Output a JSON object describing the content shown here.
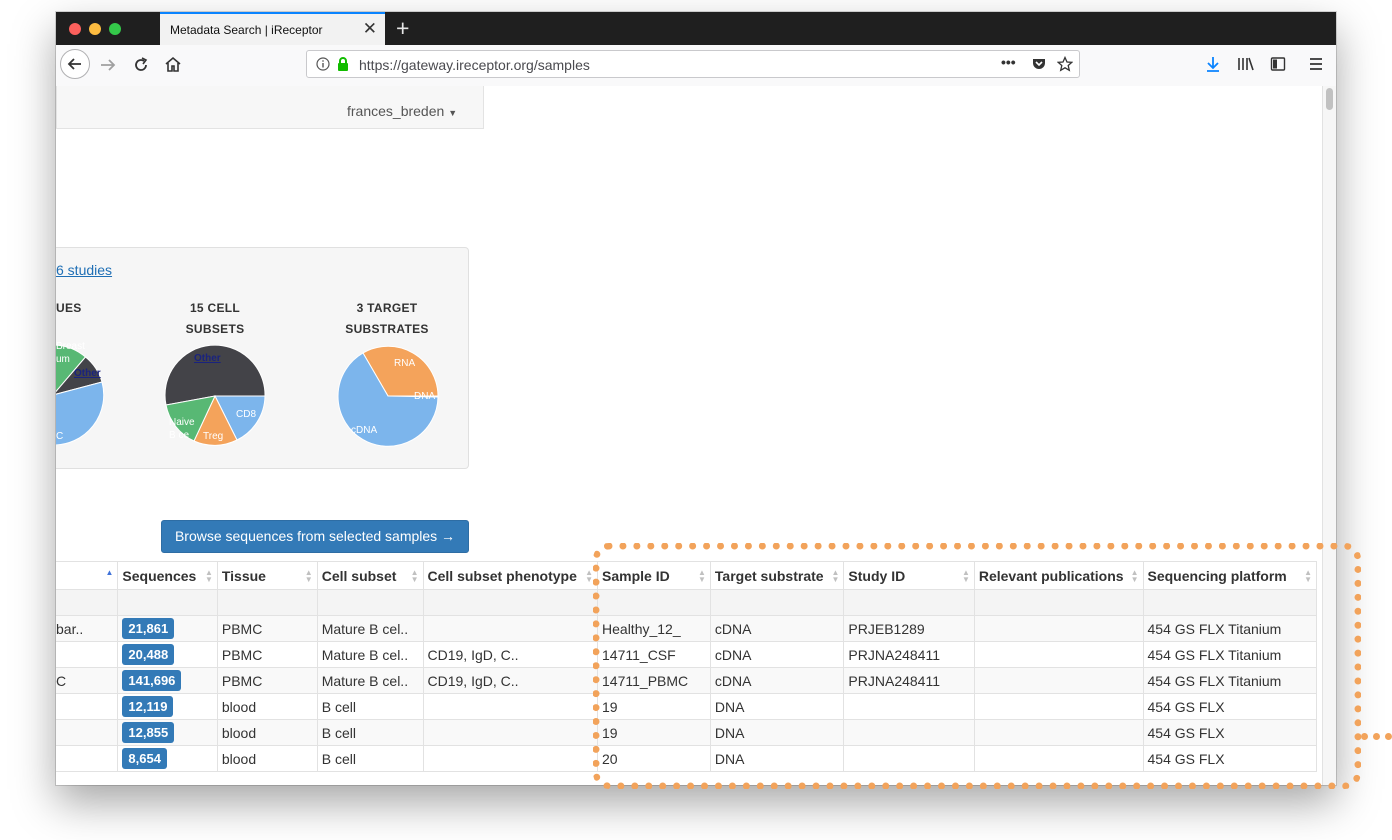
{
  "browser": {
    "tab_title": "Metadata Search | iReceptor",
    "url": "https://gateway.ireceptor.org/samples",
    "page_actions_icon": "•••",
    "new_tab_label": "+"
  },
  "header": {
    "username": "frances_breden"
  },
  "stats": {
    "studies_link": "6 studies",
    "tissues_heading": "UES",
    "cell_subsets_heading_line1": "15 CELL",
    "cell_subsets_heading_line2": "SUBSETS",
    "target_substrates_heading_line1": "3 TARGET",
    "target_substrates_heading_line2": "SUBSTRATES",
    "tissue_labels": [
      "Breast",
      "um",
      "Other",
      "C"
    ],
    "cell_subset_labels": [
      "Other",
      "CD8",
      "Naive",
      "B ce",
      "Treg"
    ],
    "substrate_labels": [
      "RNA",
      "DNA",
      "cDNA"
    ]
  },
  "colors": {
    "blue": "#7cb5ec",
    "dark": "#434348",
    "green": "#58b874",
    "orange": "#f4a35b",
    "badge": "#337ab7",
    "highlight": "#f2a35b"
  },
  "actions": {
    "browse_button": "Browse sequences from selected samples →"
  },
  "table": {
    "headers": [
      "Sequences",
      "Tissue",
      "Cell subset",
      "Cell subset phenotype",
      "Sample ID",
      "Target substrate",
      "Study ID",
      "Relevant publications",
      "Sequencing platform"
    ],
    "rows": [
      {
        "first": "bar..",
        "sequences": "21,861",
        "tissue": "PBMC",
        "cell_subset": "Mature B cel..",
        "phenotype": "",
        "sample_id": "Healthy_12_",
        "substrate": "cDNA",
        "study_id": "PRJEB1289",
        "publications": "",
        "platform": "454 GS FLX Titanium"
      },
      {
        "first": "",
        "sequences": "20,488",
        "tissue": "PBMC",
        "cell_subset": "Mature B cel..",
        "phenotype": "CD19, IgD, C..",
        "sample_id": "14711_CSF",
        "substrate": "cDNA",
        "study_id": "PRJNA248411",
        "publications": "",
        "platform": "454 GS FLX Titanium"
      },
      {
        "first": "C",
        "sequences": "141,696",
        "tissue": "PBMC",
        "cell_subset": "Mature B cel..",
        "phenotype": "CD19, IgD, C..",
        "sample_id": "14711_PBMC",
        "substrate": "cDNA",
        "study_id": "PRJNA248411",
        "publications": "",
        "platform": "454 GS FLX Titanium"
      },
      {
        "first": "",
        "sequences": "12,119",
        "tissue": "blood",
        "cell_subset": "B cell",
        "phenotype": "",
        "sample_id": "19",
        "substrate": "DNA",
        "study_id": "",
        "publications": "",
        "platform": "454 GS FLX"
      },
      {
        "first": "",
        "sequences": "12,855",
        "tissue": "blood",
        "cell_subset": "B cell",
        "phenotype": "",
        "sample_id": "19",
        "substrate": "DNA",
        "study_id": "",
        "publications": "",
        "platform": "454 GS FLX"
      },
      {
        "first": "",
        "sequences": "8,654",
        "tissue": "blood",
        "cell_subset": "B cell",
        "phenotype": "",
        "sample_id": "20",
        "substrate": "DNA",
        "study_id": "",
        "publications": "",
        "platform": "454 GS FLX"
      }
    ]
  }
}
